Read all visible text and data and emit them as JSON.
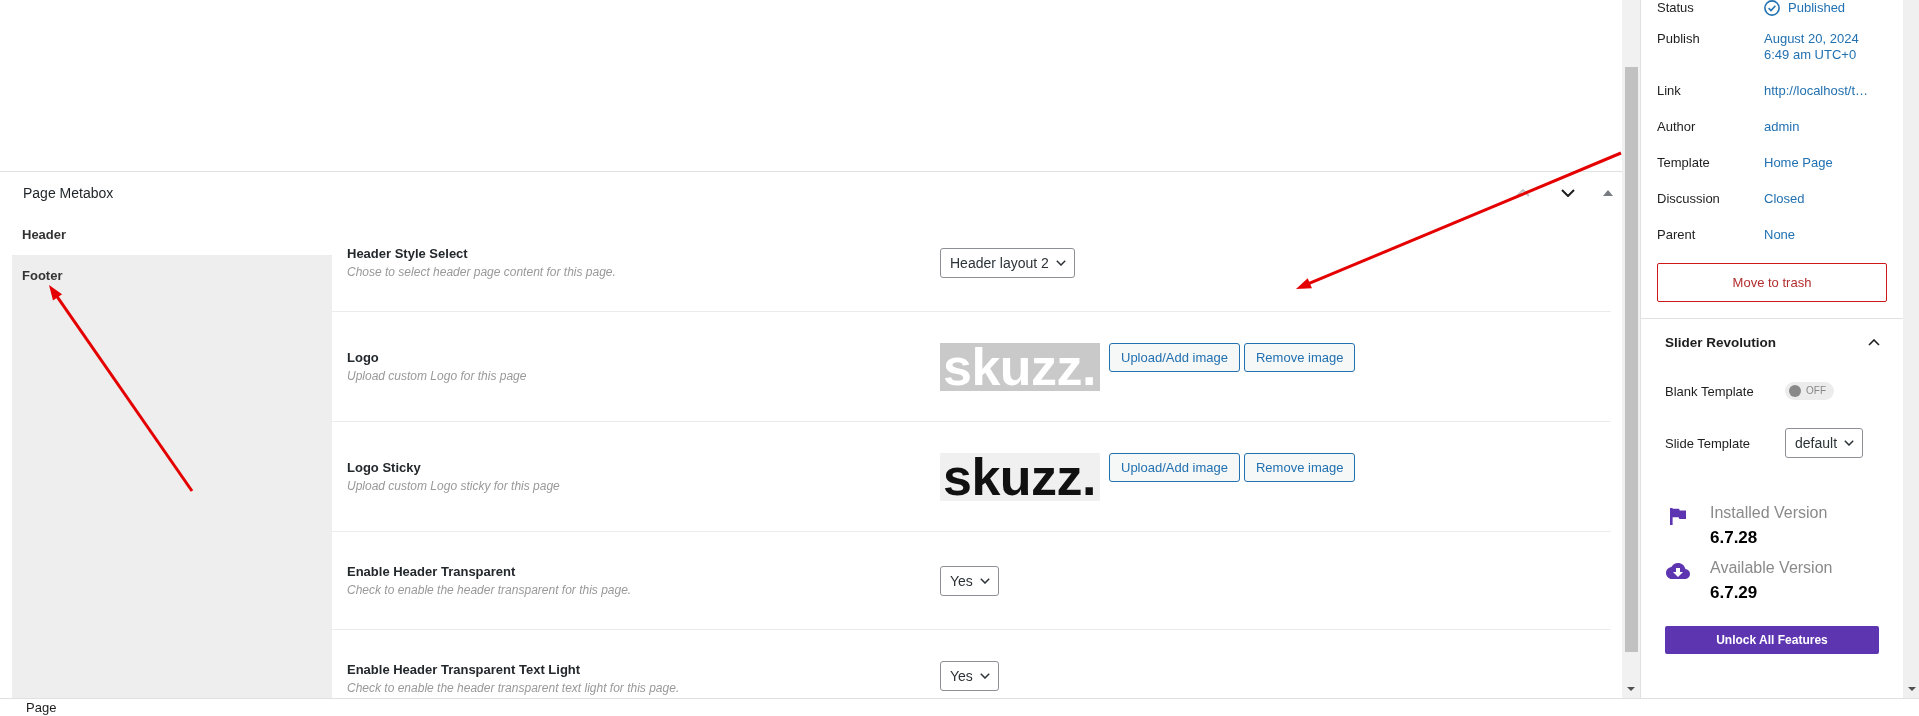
{
  "editor": {
    "metabox": {
      "title": "Page Metabox",
      "expanded": true,
      "controls": [
        {
          "kind": "up",
          "disabled": true
        },
        {
          "kind": "down",
          "disabled": false
        }
      ],
      "tabs": [
        {
          "label": "Header",
          "selected": true
        },
        {
          "label": "Footer",
          "selected": false
        }
      ],
      "fields": [
        {
          "kind": "select",
          "label": "Header Style Select",
          "description": "Chose to select header page content for this page.",
          "value": "Header layout 2"
        },
        {
          "kind": "image",
          "label": "Logo",
          "description": "Upload custom Logo for this page",
          "image": {
            "kind": "light",
            "text": "skuzz."
          },
          "buttons": [
            "Upload/Add image",
            "Remove image"
          ]
        },
        {
          "kind": "image",
          "label": "Logo Sticky",
          "description": "Upload custom Logo sticky for this page",
          "image": {
            "kind": "dark",
            "text": "skuzz."
          },
          "buttons": [
            "Upload/Add image",
            "Remove image"
          ]
        },
        {
          "kind": "select",
          "label": "Enable Header Transparent",
          "description": "Check to enable the header transparent for this page.",
          "value": "Yes"
        },
        {
          "kind": "select",
          "label": "Enable Header Transparent Text Light",
          "description": "Check to enable the header transparent text light for this page.",
          "value": "Yes"
        }
      ]
    }
  },
  "annotations": [
    {
      "kind": "arrow"
    },
    {
      "kind": "arrow"
    }
  ],
  "sidebar": {
    "summary": [
      {
        "kind": "status",
        "label": "Status",
        "lines": [
          "Published"
        ]
      },
      {
        "kind": "link",
        "label": "Publish",
        "lines": [
          "August 20, 2024",
          "6:49 am UTC+0"
        ]
      },
      {
        "kind": "link",
        "label": "Link",
        "lines": [
          "http://localhost/t…"
        ]
      },
      {
        "kind": "link",
        "label": "Author",
        "lines": [
          "admin"
        ]
      },
      {
        "kind": "link",
        "label": "Template",
        "lines": [
          "Home Page"
        ]
      },
      {
        "kind": "link",
        "label": "Discussion",
        "lines": [
          "Closed"
        ]
      },
      {
        "kind": "link",
        "label": "Parent",
        "lines": [
          "None"
        ]
      }
    ],
    "trash_button": "Move to trash",
    "slider_revolution": {
      "title": "Slider Revolution",
      "expanded": true,
      "blank_template": {
        "label": "Blank Template",
        "on": false,
        "toggle_label": "OFF"
      },
      "slide_template": {
        "label": "Slide Template",
        "value": "default"
      },
      "versions": [
        {
          "kind": "installed",
          "label": "Installed Version",
          "number": "6.7.28"
        },
        {
          "kind": "available",
          "label": "Available Version",
          "number": "6.7.29"
        }
      ],
      "unlock_button": "Unlock All Features"
    }
  },
  "status_bar": {
    "breadcrumb": "Page"
  }
}
